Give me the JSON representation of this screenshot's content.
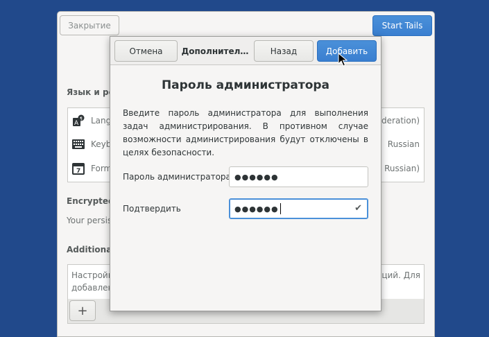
{
  "background_window": {
    "close_label": "Закрытие",
    "start_label": "Start Tails",
    "section_language": "Язык и рег",
    "rows": [
      {
        "left": "Langu",
        "right": "ederation)",
        "icon": "language-icon"
      },
      {
        "left": "Keyb",
        "right": "Russian",
        "icon": "keyboard-icon"
      },
      {
        "left": "Forma",
        "right": "– Russian)",
        "icon": "calendar-icon"
      }
    ],
    "encrypted_label": "Encrypted",
    "persistence_text": "Your persis",
    "additional_label": "Additional",
    "additional_left": "Настройк",
    "additional_left2": "добавлен",
    "additional_right": "ций. Для",
    "plus_label": "+"
  },
  "dialog": {
    "header": {
      "cancel_label": "Отмена",
      "title": "Дополнител…",
      "back_label": "Назад",
      "add_label": "Добавить"
    },
    "title": "Пароль администратора",
    "description": "Введите пароль администратора для выполнения задач администрирования. В противном случае возможности администрирования будут отключены в целях безопасности.",
    "password_label": "Пароль администратора",
    "password_value": "●●●●●●",
    "confirm_label": "Подтвердить",
    "confirm_value": "●●●●●●",
    "confirm_check": "✔"
  },
  "colors": {
    "desktop": "#21498b",
    "accent": "#4a90d9"
  }
}
